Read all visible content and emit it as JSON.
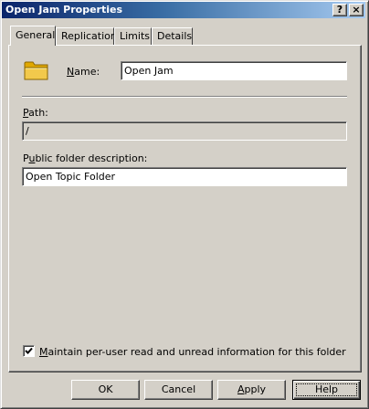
{
  "window": {
    "title": "Open Jam Properties",
    "help_button": "?",
    "close_button": "×"
  },
  "tabs": [
    {
      "label": "General",
      "active": true
    },
    {
      "label": "Replication",
      "active": false
    },
    {
      "label": "Limits",
      "active": false
    },
    {
      "label": "Details",
      "active": false
    }
  ],
  "general": {
    "folder_icon": "folder-icon",
    "name_label_first": "N",
    "name_label_rest": "ame:",
    "name_value": "Open Jam",
    "path_label_first": "P",
    "path_label_rest": "ath:",
    "path_value": "/",
    "description_label_first": "P",
    "description_label_mid": "u",
    "description_label_rest": "blic folder description:",
    "description_value": "Open Topic Folder",
    "checkbox_checked": true,
    "checkbox_label_first": "M",
    "checkbox_label_rest": "aintain per-user read and unread information for this folder"
  },
  "buttons": {
    "ok": "OK",
    "cancel": "Cancel",
    "apply_first": "A",
    "apply_rest": "pply",
    "help": "Help"
  },
  "colors": {
    "titlebar_start": "#0a246a",
    "titlebar_end": "#a6caf0",
    "dialog_face": "#d4d0c8",
    "folder": "#f2c94c"
  }
}
